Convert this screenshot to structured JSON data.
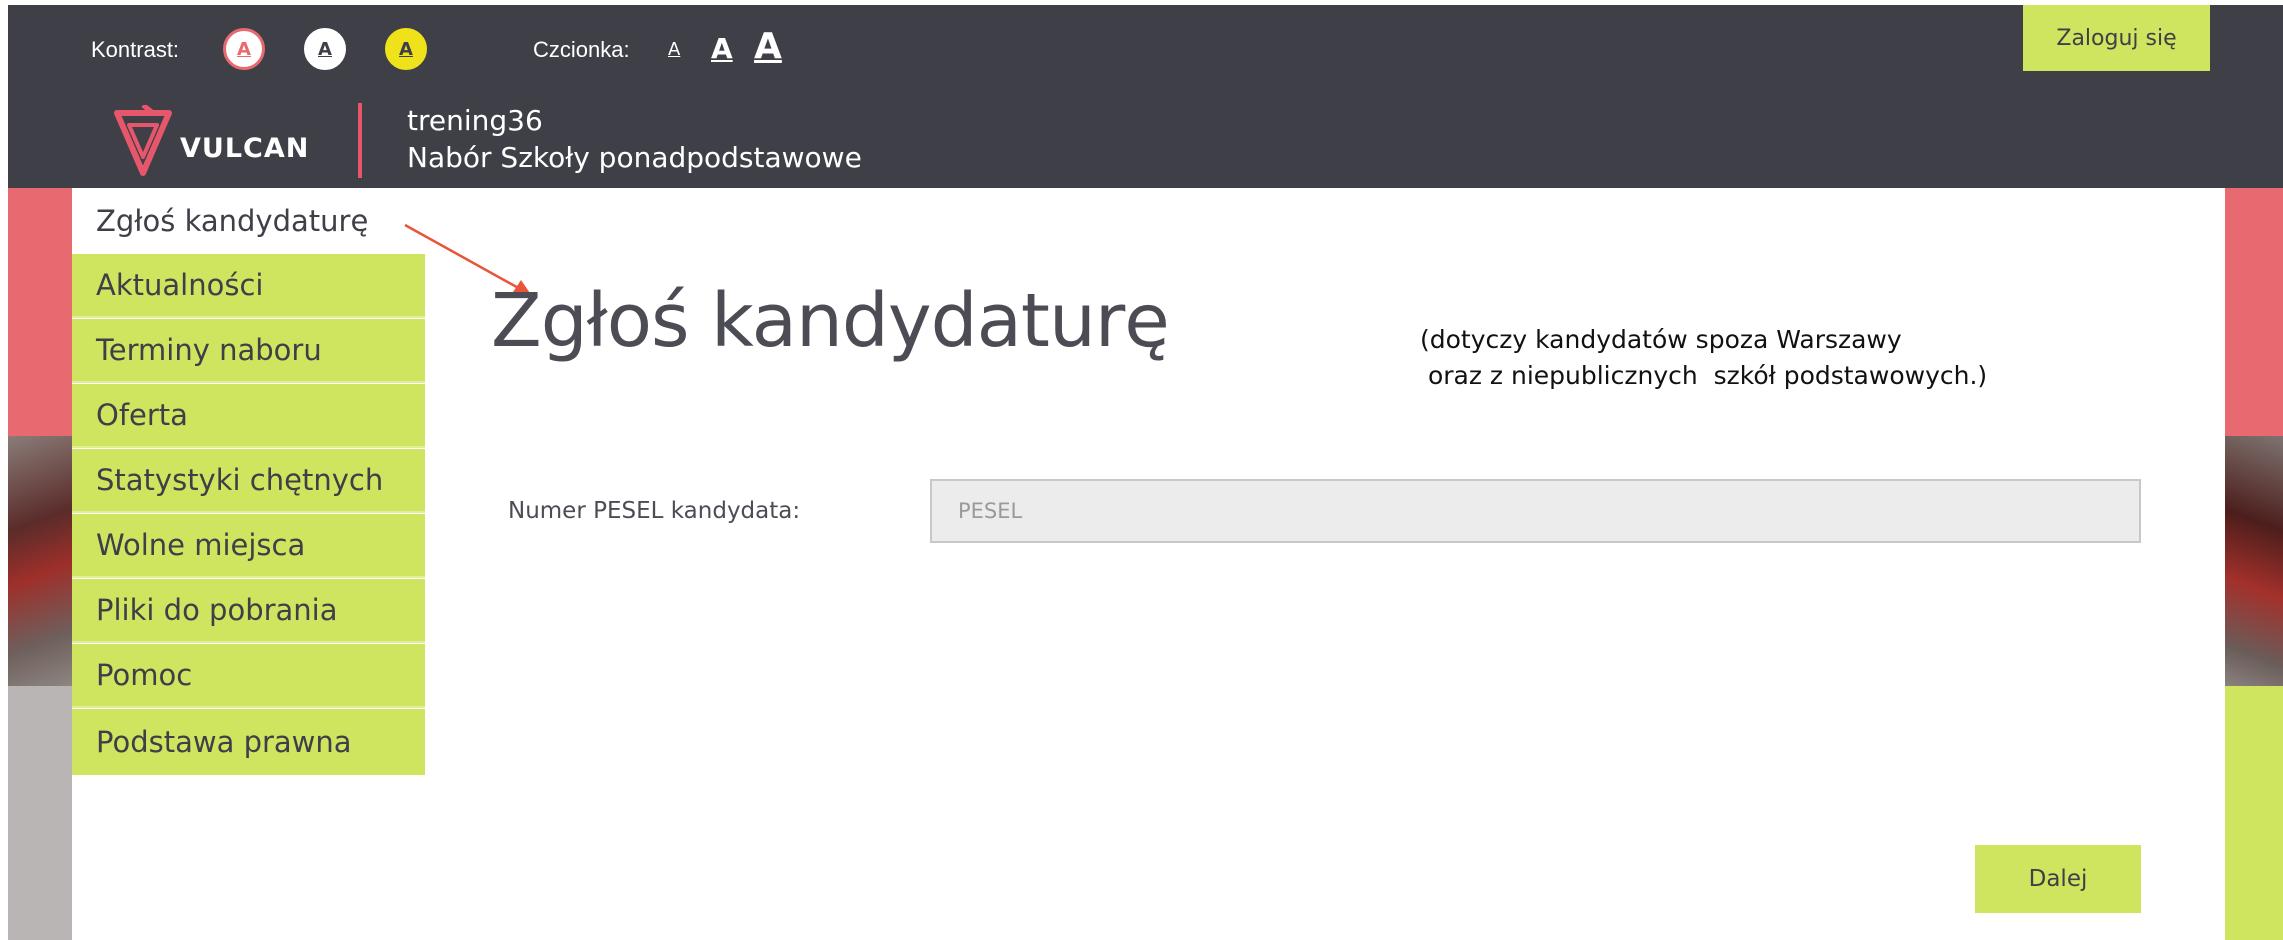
{
  "header": {
    "contrast_label": "Kontrast:",
    "contrast_options": [
      "A",
      "A",
      "A"
    ],
    "font_label": "Czcionka:",
    "font_options": [
      "A",
      "A",
      "A"
    ],
    "login_label": "Zaloguj się",
    "logo_text": "VULCAN",
    "site_name": "trening36",
    "site_subtitle": "Nabór Szkoły ponadpodstawowe"
  },
  "sidebar": {
    "items": [
      {
        "label": "Zgłoś kandydaturę",
        "active": true
      },
      {
        "label": "Aktualności"
      },
      {
        "label": "Terminy naboru"
      },
      {
        "label": "Oferta"
      },
      {
        "label": "Statystyki chętnych"
      },
      {
        "label": "Wolne miejsca"
      },
      {
        "label": "Pliki do pobrania"
      },
      {
        "label": "Pomoc"
      },
      {
        "label": "Podstawa prawna"
      }
    ]
  },
  "main": {
    "title": "Zgłoś kandydaturę",
    "note": "(dotyczy kandydatów spoza Warszawy\n oraz z niepublicznych  szkół podstawowych.)",
    "pesel_label": "Numer PESEL kandydata:",
    "pesel_placeholder": "PESEL",
    "pesel_value": "",
    "next_label": "Dalej"
  },
  "colors": {
    "header_bg": "#3f3f48",
    "accent_lime": "#cfe560",
    "accent_pink": "#e8696f",
    "contrast_yellow": "#f0e21a",
    "annotation_arrow": "#e8553a"
  },
  "icons": [
    "vulcan-logo-icon",
    "annotation-arrow-icon"
  ]
}
